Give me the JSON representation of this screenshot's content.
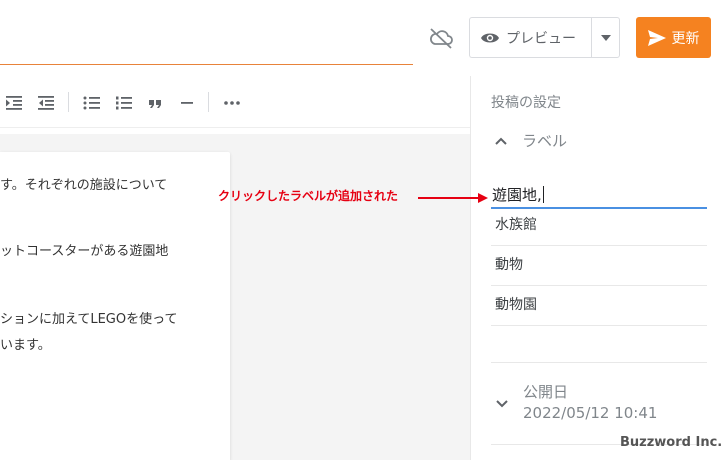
{
  "header": {
    "preview_label": "プレビュー",
    "update_label": "更新",
    "accent_color": "#f58220"
  },
  "editor": {
    "lines": [
      "す。それぞれの施設について",
      "ットコースターがある遊園地",
      "ションに加えてLEGOを使って",
      "います。"
    ]
  },
  "sidebar": {
    "title": "投稿の設定",
    "label_section": "ラベル",
    "label_input_value": "遊園地,",
    "label_options": [
      "水族館",
      "動物",
      "動物園"
    ],
    "publish_label": "公開日",
    "publish_date": "2022/05/12 10:41"
  },
  "annotation": {
    "text": "クリックしたラベルが追加された",
    "color": "#e60012"
  },
  "watermark": "Buzzword Inc."
}
